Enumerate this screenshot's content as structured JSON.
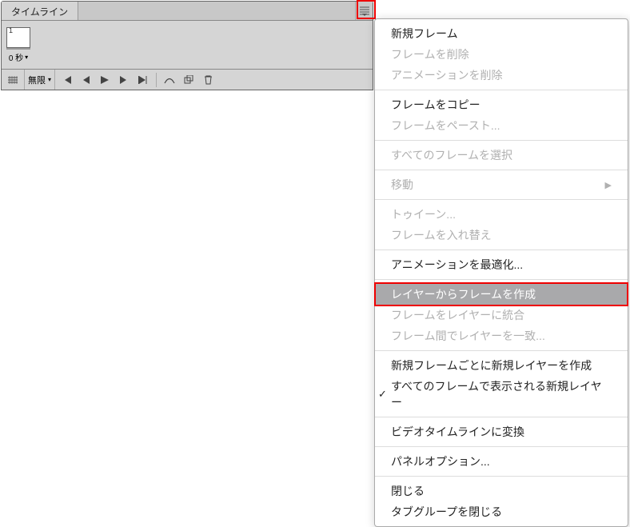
{
  "panel": {
    "tab_title": "タイムライン",
    "frame": {
      "number": "1",
      "time_label": "0 秒"
    }
  },
  "controls": {
    "loop_label": "無限"
  },
  "menu": {
    "items": [
      {
        "label": "新規フレーム",
        "disabled": false
      },
      {
        "label": "フレームを削除",
        "disabled": true
      },
      {
        "label": "アニメーションを削除",
        "disabled": true
      }
    ],
    "group2": [
      {
        "label": "フレームをコピー",
        "disabled": false
      },
      {
        "label": "フレームをペースト...",
        "disabled": true
      }
    ],
    "group3": [
      {
        "label": "すべてのフレームを選択",
        "disabled": true
      }
    ],
    "group4": [
      {
        "label": "移動",
        "disabled": true,
        "submenu": true
      }
    ],
    "group5": [
      {
        "label": "トゥイーン...",
        "disabled": true
      },
      {
        "label": "フレームを入れ替え",
        "disabled": true
      }
    ],
    "group6": [
      {
        "label": "アニメーションを最適化...",
        "disabled": false
      }
    ],
    "group7": [
      {
        "label": "レイヤーからフレームを作成",
        "disabled": false,
        "highlighted": true
      },
      {
        "label": "フレームをレイヤーに統合",
        "disabled": true
      },
      {
        "label": "フレーム間でレイヤーを一致...",
        "disabled": true
      }
    ],
    "group8": [
      {
        "label": "新規フレームごとに新規レイヤーを作成",
        "disabled": false
      },
      {
        "label": "すべてのフレームで表示される新規レイヤー",
        "disabled": false,
        "checked": true
      }
    ],
    "group9": [
      {
        "label": "ビデオタイムラインに変換",
        "disabled": false
      }
    ],
    "group10": [
      {
        "label": "パネルオプション...",
        "disabled": false
      }
    ],
    "group11": [
      {
        "label": "閉じる",
        "disabled": false
      },
      {
        "label": "タブグループを閉じる",
        "disabled": false
      }
    ]
  }
}
